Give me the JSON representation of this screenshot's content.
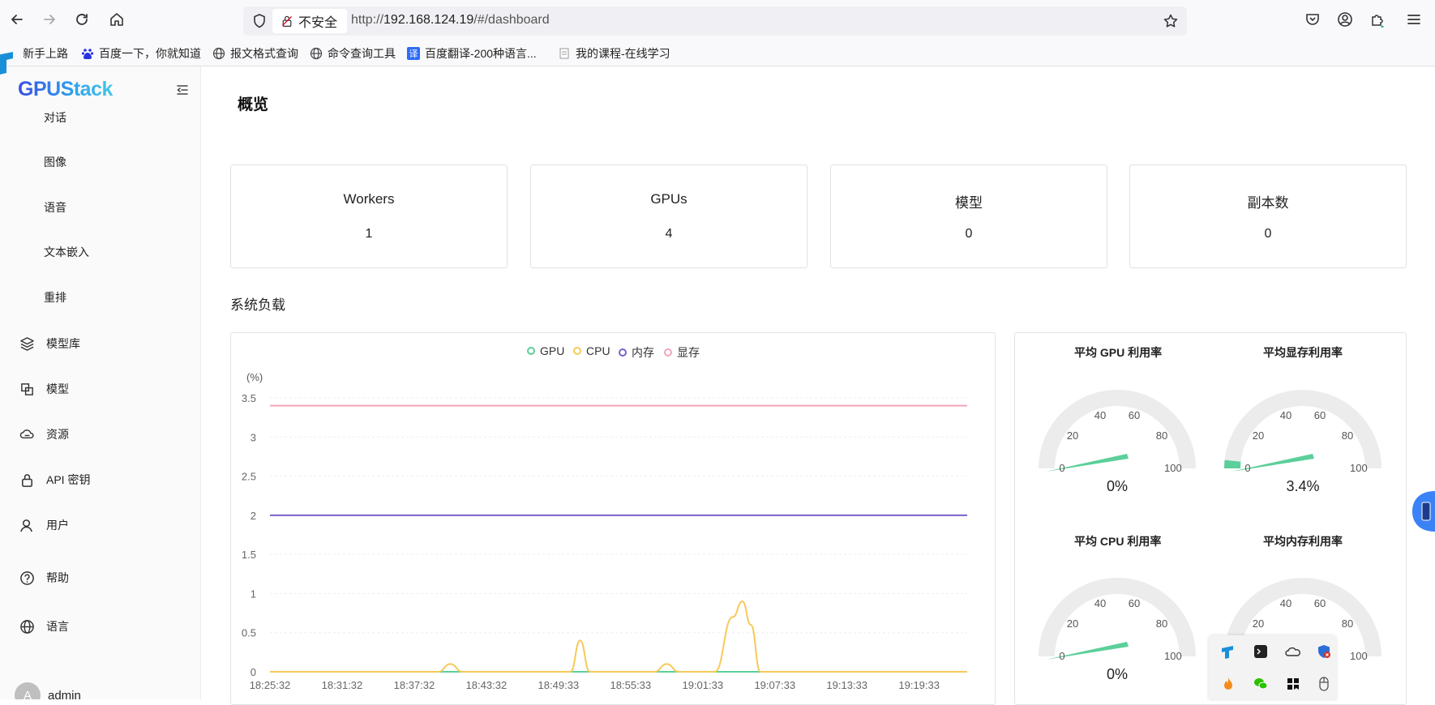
{
  "browser": {
    "url_security_label": "不安全",
    "url_prefix": "http://",
    "url_host": "192.168.124.19",
    "url_path": "/#/dashboard",
    "bookmarks": [
      {
        "label": "新手上路",
        "icon": "firefox-icon"
      },
      {
        "label": "百度一下，你就知道",
        "icon": "baidu-icon"
      },
      {
        "label": "报文格式查询",
        "icon": "globe-icon"
      },
      {
        "label": "命令查询工具",
        "icon": "globe-icon"
      },
      {
        "label": "百度翻译-200种语言...",
        "icon": "translate-icon"
      },
      {
        "label": "我的课程-在线学习",
        "icon": "document-icon"
      }
    ]
  },
  "sidebar": {
    "logo": "GPUStack",
    "sub_items": [
      "对话",
      "图像",
      "语音",
      "文本嵌入",
      "重排"
    ],
    "menu_items": [
      {
        "label": "模型库",
        "icon": "layers-icon"
      },
      {
        "label": "模型",
        "icon": "models-icon"
      },
      {
        "label": "资源",
        "icon": "cloud-resource-icon"
      },
      {
        "label": "API 密钥",
        "icon": "lock-icon"
      },
      {
        "label": "用户",
        "icon": "user-icon"
      },
      {
        "label": "帮助",
        "icon": "help-icon"
      },
      {
        "label": "语言",
        "icon": "globe-icon"
      }
    ],
    "user": {
      "avatar_letter": "A",
      "name": "admin"
    }
  },
  "main": {
    "title": "概览",
    "stats": [
      {
        "label": "Workers",
        "value": "1"
      },
      {
        "label": "GPUs",
        "value": "4"
      },
      {
        "label": "模型",
        "value": "0"
      },
      {
        "label": "副本数",
        "value": "0"
      }
    ],
    "section_title": "系统负载",
    "gauges": [
      {
        "title": "平均 GPU 利用率",
        "value": 0,
        "display": "0%",
        "color": "#5ccf9a"
      },
      {
        "title": "平均显存利用率",
        "value": 3.4,
        "display": "3.4%",
        "color": "#5ccf9a"
      },
      {
        "title": "平均 CPU 利用率",
        "value": 0,
        "display": "0%",
        "color": "#5ccf9a"
      },
      {
        "title": "平均内存利用率",
        "value": null,
        "display": "",
        "color": "#5ccf9a"
      }
    ],
    "gauge_ticks": [
      "0",
      "20",
      "40",
      "60",
      "80",
      "100"
    ]
  },
  "chart_data": {
    "type": "line",
    "ylabel": "(%)",
    "ylim": [
      0,
      3.5
    ],
    "yticks": [
      "0",
      "0.5",
      "1",
      "1.5",
      "2",
      "2.5",
      "3",
      "3.5"
    ],
    "xticks": [
      "18:25:32",
      "18:31:32",
      "18:37:32",
      "18:43:32",
      "18:49:33",
      "18:55:33",
      "19:01:33",
      "19:07:33",
      "19:13:33",
      "19:19:33"
    ],
    "x_range_minutes": [
      0,
      58
    ],
    "legend_position": "top",
    "grid": true,
    "series": [
      {
        "name": "GPU",
        "color": "#5ccf9a",
        "points": [
          [
            0,
            0
          ],
          [
            58,
            0
          ]
        ]
      },
      {
        "name": "CPU",
        "color": "#f7c95a",
        "points": [
          [
            0,
            0
          ],
          [
            14,
            0
          ],
          [
            15,
            0.1
          ],
          [
            16,
            0
          ],
          [
            25,
            0
          ],
          [
            25.8,
            0.4
          ],
          [
            26.6,
            0
          ],
          [
            32,
            0
          ],
          [
            33,
            0.1
          ],
          [
            34,
            0
          ],
          [
            37,
            0
          ],
          [
            38.5,
            0.7
          ],
          [
            39.3,
            0.9
          ],
          [
            40,
            0.6
          ],
          [
            40.8,
            0
          ],
          [
            58,
            0
          ]
        ]
      },
      {
        "name": "内存",
        "color": "#7b61c9",
        "points": [
          [
            0,
            2
          ],
          [
            58,
            2
          ]
        ]
      },
      {
        "name": "显存",
        "color": "#f4a5b8",
        "points": [
          [
            0,
            3.4
          ],
          [
            58,
            3.4
          ]
        ]
      }
    ]
  }
}
